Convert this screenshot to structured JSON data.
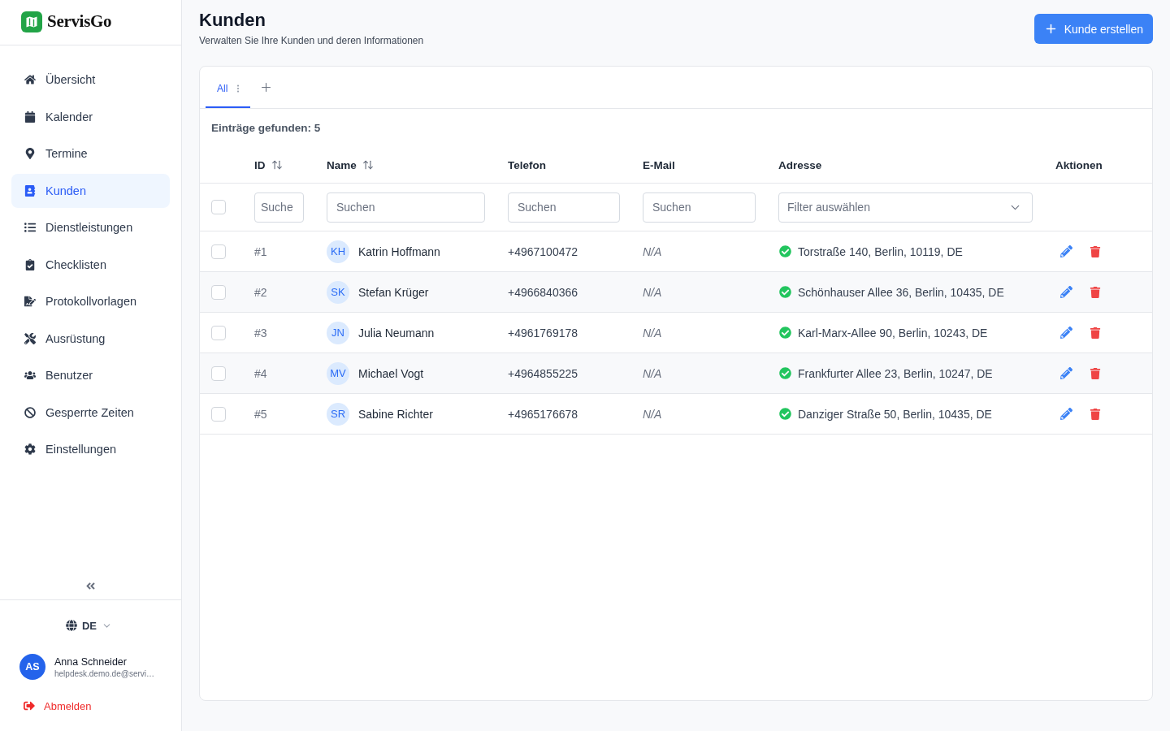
{
  "brand": {
    "name": "ServisGo"
  },
  "sidebar": {
    "items": [
      {
        "label": "Übersicht",
        "selected": false
      },
      {
        "label": "Kalender",
        "selected": false
      },
      {
        "label": "Termine",
        "selected": false
      },
      {
        "label": "Kunden",
        "selected": true
      },
      {
        "label": "Dienstleistungen",
        "selected": false
      },
      {
        "label": "Checklisten",
        "selected": false
      },
      {
        "label": "Protokollvorlagen",
        "selected": false
      },
      {
        "label": "Ausrüstung",
        "selected": false
      },
      {
        "label": "Benutzer",
        "selected": false
      },
      {
        "label": "Gesperrte Zeiten",
        "selected": false
      },
      {
        "label": "Einstellungen",
        "selected": false
      }
    ],
    "language": {
      "code": "DE"
    },
    "user": {
      "initials": "AS",
      "name": "Anna Schneider",
      "email": "helpdesk.demo.de@servi…"
    },
    "logout": {
      "label": "Abmelden"
    }
  },
  "page": {
    "title": "Kunden",
    "subtitle": "Verwalten Sie Ihre Kunden und deren Informationen",
    "create_button": {
      "label": "Kunde erstellen"
    }
  },
  "tabs": [
    {
      "label": "All",
      "selected": true
    }
  ],
  "results": {
    "label": "Einträge gefunden: 5"
  },
  "table": {
    "select_all": {
      "checked": false
    },
    "columns": [
      {
        "label": "ID",
        "sortable": true,
        "filter": {
          "kind": "text",
          "placeholder": "Suche"
        }
      },
      {
        "label": "Name",
        "sortable": true,
        "filter": {
          "kind": "text",
          "placeholder": "Suchen"
        }
      },
      {
        "label": "Telefon",
        "sortable": false,
        "filter": {
          "kind": "text",
          "placeholder": "Suchen"
        }
      },
      {
        "label": "E-Mail",
        "sortable": false,
        "filter": {
          "kind": "text",
          "placeholder": "Suchen"
        }
      },
      {
        "label": "Adresse",
        "sortable": false,
        "filter": {
          "kind": "select",
          "placeholder": "Filter auswählen"
        }
      },
      {
        "label": "Aktionen",
        "sortable": false
      }
    ],
    "rows": [
      {
        "checked": false,
        "id": "#1",
        "initials": "KH",
        "name": "Katrin Hoffmann",
        "phone": "+4967100472",
        "email": "N/A",
        "address": "Torstraße 140, Berlin, 10119, DE",
        "address_verified": true
      },
      {
        "checked": false,
        "id": "#2",
        "initials": "SK",
        "name": "Stefan Krüger",
        "phone": "+4966840366",
        "email": "N/A",
        "address": "Schönhauser Allee 36, Berlin, 10435, DE",
        "address_verified": true
      },
      {
        "checked": false,
        "id": "#3",
        "initials": "JN",
        "name": "Julia Neumann",
        "phone": "+4961769178",
        "email": "N/A",
        "address": "Karl-Marx-Allee 90, Berlin, 10243, DE",
        "address_verified": true
      },
      {
        "checked": false,
        "id": "#4",
        "initials": "MV",
        "name": "Michael Vogt",
        "phone": "+4964855225",
        "email": "N/A",
        "address": "Frankfurter Allee 23, Berlin, 10247, DE",
        "address_verified": true
      },
      {
        "checked": false,
        "id": "#5",
        "initials": "SR",
        "name": "Sabine Richter",
        "phone": "+4965176678",
        "email": "N/A",
        "address": "Danziger Straße 50, Berlin, 10435, DE",
        "address_verified": true
      }
    ]
  }
}
